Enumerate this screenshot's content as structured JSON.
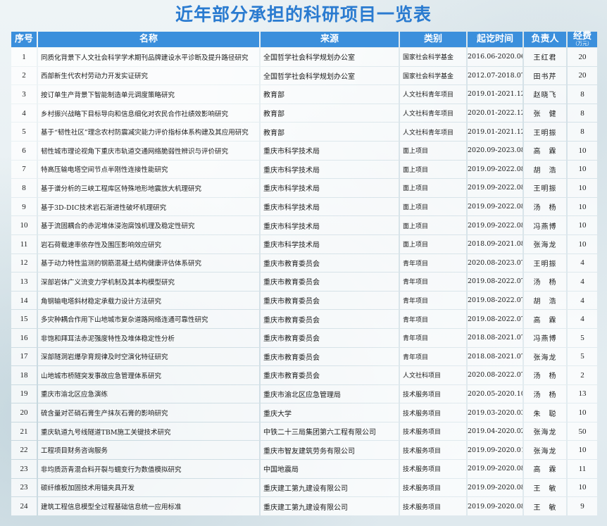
{
  "title": "近年部分承担的科研项目一览表",
  "headers": {
    "index": "序号",
    "name": "名称",
    "source": "来源",
    "category": "类别",
    "period": "起讫时间",
    "leader": "负责人",
    "funding": "经费",
    "funding_unit": "（万元）"
  },
  "rows": [
    {
      "index": "1",
      "name": "同质化背景下人文社会科学学术期刊品牌建设水平诊断及提升路径研究",
      "source": "全国哲学社会科学规划办公室",
      "category": "国家社会科学基金",
      "period": "2016.06-2020.06",
      "leader": "王红君",
      "funding": "20"
    },
    {
      "index": "2",
      "name": "西部新生代农村劳动力开发实证研究",
      "source": "全国哲学社会科学规划办公室",
      "category": "国家社会科学基金",
      "period": "2012.07-2018.07",
      "leader": "田书芹",
      "funding": "20"
    },
    {
      "index": "3",
      "name": "按订单生产背景下智能制造单元调度策略研究",
      "source": "教育部",
      "category": "人文社科青年项目",
      "period": "2019.01-2021.12",
      "leader": "赵晓飞",
      "funding": "8"
    },
    {
      "index": "4",
      "name": "乡村振兴战略下目标导向和信息细化对农民合作社绩效影响研究",
      "source": "教育部",
      "category": "人文社科青年项目",
      "period": "2020.01-2022.12",
      "leader": "张　健",
      "funding": "8"
    },
    {
      "index": "5",
      "name": "基于“韧性社区”理念农村防震减灾能力评价指标体系构建及其应用研究",
      "source": "教育部",
      "category": "人文社科青年项目",
      "period": "2019.01-2021.12",
      "leader": "王明振",
      "funding": "8"
    },
    {
      "index": "6",
      "name": "韧性城市理论视角下重庆市轨道交通网络脆弱性辨识与评价研究",
      "source": "重庆市科学技术局",
      "category": "面上项目",
      "period": "2020.09-2023.08",
      "leader": "高　霖",
      "funding": "10"
    },
    {
      "index": "7",
      "name": "特高压输电塔空间节点半刚性连接性能研究",
      "source": "重庆市科学技术局",
      "category": "面上项目",
      "period": "2019.09-2022.08",
      "leader": "胡　浩",
      "funding": "10"
    },
    {
      "index": "8",
      "name": "基于谱分析的三峡工程库区特殊地形地震放大机理研究",
      "source": "重庆市科学技术局",
      "category": "面上项目",
      "period": "2019.09-2022.08",
      "leader": "王明振",
      "funding": "10"
    },
    {
      "index": "9",
      "name": "基于3D-DIC技术岩石渐进性破坏机理研究",
      "source": "重庆市科学技术局",
      "category": "面上项目",
      "period": "2019.09-2022.08",
      "leader": "汤　杨",
      "funding": "10"
    },
    {
      "index": "10",
      "name": "基于流固耦合的赤泥堆体浸泡腐蚀机理及稳定性研究",
      "source": "重庆市科学技术局",
      "category": "面上项目",
      "period": "2019.09-2022.08",
      "leader": "冯燕博",
      "funding": "10"
    },
    {
      "index": "11",
      "name": "岩石荷载速率依存性及围压影响效应研究",
      "source": "重庆市科学技术局",
      "category": "面上项目",
      "period": "2018.09-2021.08",
      "leader": "张海龙",
      "funding": "10"
    },
    {
      "index": "12",
      "name": "基于动力特性监测的钢筋混凝土结构健康评估体系研究",
      "source": "重庆市教育委员会",
      "category": "青年项目",
      "period": "2020.08-2023.07",
      "leader": "王明振",
      "funding": "4"
    },
    {
      "index": "13",
      "name": "深部岩体广义流变力学机制及其本构模型研究",
      "source": "重庆市教育委员会",
      "category": "青年项目",
      "period": "2019.08-2022.07",
      "leader": "汤　杨",
      "funding": "4"
    },
    {
      "index": "14",
      "name": "角钢输电塔斜材稳定承载力设计方法研究",
      "source": "重庆市教育委员会",
      "category": "青年项目",
      "period": "2019.08-2022.07",
      "leader": "胡　浩",
      "funding": "4"
    },
    {
      "index": "15",
      "name": "多灾种耦合作用下山地城市复杂道路网络连通可靠性研究",
      "source": "重庆市教育委员会",
      "category": "青年项目",
      "period": "2019.08-2022.07",
      "leader": "高　霖",
      "funding": "4"
    },
    {
      "index": "16",
      "name": "非饱和拜耳法赤泥强度特性及堆体稳定性分析",
      "source": "重庆市教育委员会",
      "category": "青年项目",
      "period": "2018.08-2021.07",
      "leader": "冯燕博",
      "funding": "5"
    },
    {
      "index": "17",
      "name": "深部隧洞岩爆孕育规律及时空演化特征研究",
      "source": "重庆市教育委员会",
      "category": "青年项目",
      "period": "2018.08-2021.07",
      "leader": "张海龙",
      "funding": "5"
    },
    {
      "index": "18",
      "name": "山地城市桥隧突发事故应急管理体系研究",
      "source": "重庆市教育委员会",
      "category": "人文社科项目",
      "period": "2020.08-2022.07",
      "leader": "汤　杨",
      "funding": "2"
    },
    {
      "index": "19",
      "name": "重庆市渝北区应急演练",
      "source": "重庆市渝北区应急管理局",
      "category": "技术服务项目",
      "period": "2020.05-2020.10",
      "leader": "汤　杨",
      "funding": "13"
    },
    {
      "index": "20",
      "name": "硫含量对芒硝石膏生产抹灰石膏的影响研究",
      "source": "重庆大学",
      "category": "技术服务项目",
      "period": "2019.03-2020.03",
      "leader": "朱　聪",
      "funding": "10"
    },
    {
      "index": "21",
      "name": "重庆轨道九号线隧道TBM施工关键技术研究",
      "source": "中铁二十三局集团第六工程有限公司",
      "category": "技术服务项目",
      "period": "2019.04-2020.02",
      "leader": "张海龙",
      "funding": "50"
    },
    {
      "index": "22",
      "name": "工程项目财务咨询服务",
      "source": "重庆市智友建筑劳务有限公司",
      "category": "技术服务项目",
      "period": "2019.09-2020.01",
      "leader": "张海龙",
      "funding": "10"
    },
    {
      "index": "23",
      "name": "非均质沥青混合料开裂与蠕变行为数值模拟研究",
      "source": "中国地震局",
      "category": "技术服务项目",
      "period": "2019.09-2020.08",
      "leader": "高　霖",
      "funding": "11"
    },
    {
      "index": "23",
      "name": "碳纤维板加固技术用锚夹具开发",
      "source": "重庆建工第九建设有限公司",
      "category": "技术服务项目",
      "period": "2019.09-2020.08",
      "leader": "王　敏",
      "funding": "10"
    },
    {
      "index": "24",
      "name": "建筑工程信息模型全过程基础信息统一应用标准",
      "source": "重庆建工第九建设有限公司",
      "category": "技术服务项目",
      "period": "2019.09-2020.08",
      "leader": "王　敏",
      "funding": "9"
    }
  ]
}
